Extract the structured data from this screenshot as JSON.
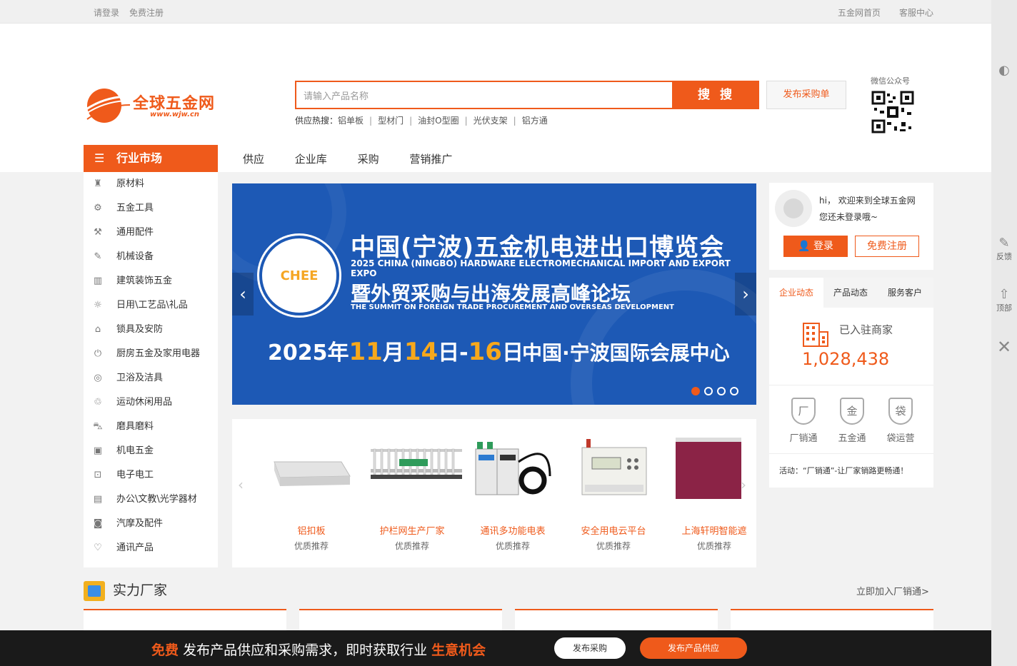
{
  "topbar": {
    "login": "请登录",
    "register": "免费注册",
    "home": "五金网首页",
    "service": "客服中心"
  },
  "logo": {
    "name": "全球五金网",
    "url": "www.wjw.cn"
  },
  "search": {
    "placeholder": "请输入产品名称",
    "button": "搜 搜",
    "publish": "发布采购单"
  },
  "hotwords": {
    "label": "供应热搜：",
    "items": [
      "铝单板",
      "型材门",
      "油封O型圈",
      "光伏支架",
      "铝方通"
    ]
  },
  "qr": {
    "label": "微信公众号"
  },
  "nav": {
    "category": "行业市场",
    "links": [
      "供应",
      "企业库",
      "采购",
      "营销推广"
    ]
  },
  "sidebar": {
    "items": [
      {
        "label": "原材料",
        "icon": "raw-material-icon"
      },
      {
        "label": "五金工具",
        "icon": "gear-icon"
      },
      {
        "label": "通用配件",
        "icon": "wrench-icon"
      },
      {
        "label": "机械设备",
        "icon": "machine-icon"
      },
      {
        "label": "建筑装饰五金",
        "icon": "building-icon"
      },
      {
        "label": "日用\\工艺品\\礼品",
        "icon": "bulb-icon"
      },
      {
        "label": "锁具及安防",
        "icon": "lock-icon"
      },
      {
        "label": "厨房五金及家用电器",
        "icon": "power-icon"
      },
      {
        "label": "卫浴及洁具",
        "icon": "shower-icon"
      },
      {
        "label": "运动休闲用品",
        "icon": "recycle-icon"
      },
      {
        "label": "磨具磨料",
        "icon": "car-icon"
      },
      {
        "label": "机电五金",
        "icon": "motor-icon"
      },
      {
        "label": "电子电工",
        "icon": "plug-icon"
      },
      {
        "label": "办公\\文教\\光学器材",
        "icon": "briefcase-icon"
      },
      {
        "label": "汽摩及配件",
        "icon": "engine-icon"
      },
      {
        "label": "通讯产品",
        "icon": "heart-icon"
      }
    ]
  },
  "banner": {
    "logo_text": "CHEE",
    "title1": "中国(宁波)五金机电进出口博览会",
    "title2": "2025 CHINA (NINGBO) HARDWARE ELECTROMECHANICAL IMPORT AND EXPORT EXPO",
    "title3": "暨外贸采购与出海发展高峰论坛",
    "title4": "THE SUMMIT ON FOREIGN TRADE PROCUREMENT AND OVERSEAS DEVELOPMENT",
    "date_pre": "2025年",
    "date_m": "11",
    "date_mu": "月",
    "date_d1": "14",
    "date_mid": "日-",
    "date_d2": "16",
    "date_end": "日",
    "venue": "中国·宁波国际会展中心",
    "slides": 4,
    "active_slide": 1
  },
  "products": [
    {
      "name": "铝扣板",
      "sub": "优质推荐"
    },
    {
      "name": "护栏网生产厂家",
      "sub": "优质推荐"
    },
    {
      "name": "通讯多功能电表",
      "sub": "优质推荐"
    },
    {
      "name": "安全用电云平台",
      "sub": "优质推荐"
    },
    {
      "name": "上海轩明智能遮",
      "sub": "优质推荐"
    }
  ],
  "user": {
    "greeting": "hi，  欢迎来到全球五金网",
    "status": "您还未登录哦~",
    "login": "登录",
    "register": "免费注册"
  },
  "stats": {
    "tabs": [
      "企业动态",
      "产品动态",
      "服务客户"
    ],
    "label": "已入驻商家",
    "value": "1,028,438",
    "badges": [
      {
        "char": "厂",
        "label": "厂销通"
      },
      {
        "char": "金",
        "label": "五金通"
      },
      {
        "char": "袋",
        "label": "袋运营"
      }
    ],
    "activity": "活动：“厂销通”-让厂家销路更畅通！"
  },
  "section": {
    "title": "实力厂家",
    "link": "立即加入厂销通>"
  },
  "bottom": {
    "free": "免费",
    "text": "发布产品供应和采购需求，即时获取行业",
    "opportunity": "生意机会",
    "btn1": "发布采购",
    "btn2": "发布产品供应"
  },
  "rail": {
    "feedback": "反馈",
    "top": "顶部"
  },
  "colors": {
    "accent": "#ef5a1b",
    "banner": "#1d59b5"
  }
}
